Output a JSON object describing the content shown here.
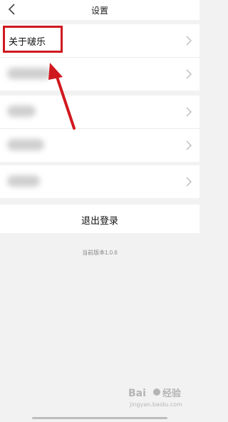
{
  "header": {
    "title": "设置",
    "back_icon": "chevron-left-icon"
  },
  "settings": {
    "group1": [
      {
        "label": "关于啵乐"
      },
      {
        "label": ""
      }
    ],
    "group2": [
      {
        "label": ""
      },
      {
        "label": ""
      }
    ],
    "group3": [
      {
        "label": ""
      }
    ],
    "row_icon": "chevron-right-icon"
  },
  "logout": {
    "label": "退出登录"
  },
  "version": {
    "text": "当前版本1.0.6"
  },
  "annotation": {
    "color": "#d0191f"
  },
  "watermark": {
    "brand": "Bai",
    "brand2": "经验",
    "url": "jingyan.baidu.com"
  }
}
